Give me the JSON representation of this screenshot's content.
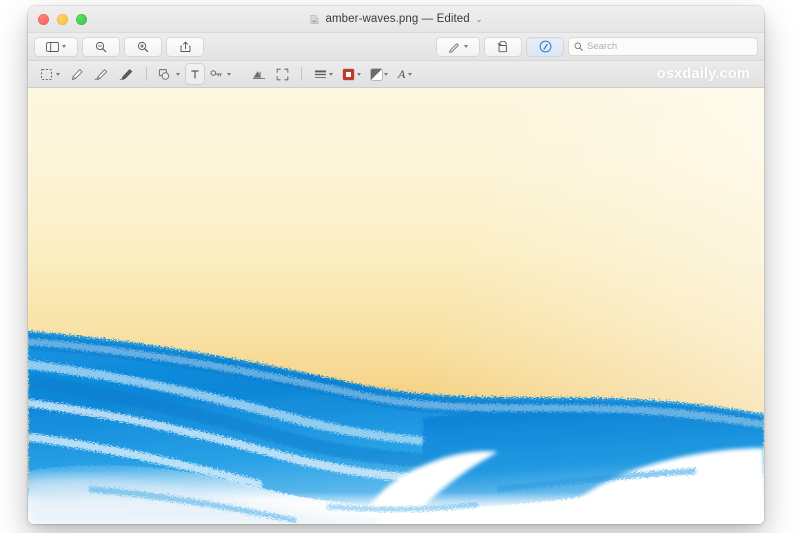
{
  "window": {
    "traffic_lights": [
      {
        "name": "close",
        "color": "#ff5f57"
      },
      {
        "name": "minimize",
        "color": "#febc2e"
      },
      {
        "name": "maximize",
        "color": "#28c840"
      }
    ],
    "title": {
      "filename": "amber-waves.png",
      "separator": "—",
      "state": "Edited",
      "full": "amber-waves.png — Edited",
      "chevron": "⌄",
      "doc_icon": "preview-document-icon"
    }
  },
  "toolbar": {
    "items": [
      {
        "name": "sidebar-toggle-button",
        "icon": "sidebar-icon",
        "label": "",
        "has_chevron": true,
        "active": false
      },
      {
        "name": "zoom-out-button",
        "icon": "zoom-out-icon",
        "label": "",
        "has_chevron": false,
        "active": false
      },
      {
        "name": "zoom-in-button",
        "icon": "zoom-in-icon",
        "label": "",
        "has_chevron": false,
        "active": false
      },
      {
        "name": "share-button",
        "icon": "share-icon",
        "label": "",
        "has_chevron": false,
        "active": false
      },
      {
        "name": "highlight-button",
        "icon": "highlighter-icon",
        "label": "",
        "has_chevron": true,
        "active": false
      },
      {
        "name": "rotate-button",
        "icon": "rotate-left-icon",
        "label": "",
        "has_chevron": false,
        "active": false
      },
      {
        "name": "markup-toggle-button",
        "icon": "markup-pen-circle-icon",
        "label": "",
        "has_chevron": false,
        "active": true
      }
    ],
    "search": {
      "placeholder": "Search",
      "value": "",
      "icon": "search-icon"
    }
  },
  "markup_toolbar": {
    "tools": [
      {
        "name": "selection-tool",
        "icon": "rect-selection-icon",
        "has_chevron": true
      },
      {
        "name": "instant-alpha-tool",
        "icon": "instant-alpha-icon",
        "has_chevron": false
      },
      {
        "name": "sketch-tool",
        "icon": "sketch-pen-icon",
        "has_chevron": false
      },
      {
        "name": "draw-tool",
        "icon": "draw-pen-icon",
        "has_chevron": false
      },
      {
        "name": "shapes-tool",
        "icon": "shapes-icon",
        "has_chevron": true
      },
      {
        "name": "text-tool",
        "icon": "text-box-icon",
        "has_chevron": false
      },
      {
        "name": "sign-tool",
        "icon": "signature-icon",
        "has_chevron": true
      },
      {
        "name": "adjust-color-tool",
        "icon": "adjust-color-icon",
        "has_chevron": false
      },
      {
        "name": "adjust-size-tool",
        "icon": "adjust-size-icon",
        "has_chevron": false
      },
      {
        "name": "shape-style-tool",
        "icon": "shape-style-icon",
        "has_chevron": true
      },
      {
        "name": "border-color-tool",
        "icon": "border-color-swatch",
        "has_chevron": true
      },
      {
        "name": "fill-color-tool",
        "icon": "fill-color-swatch",
        "has_chevron": true
      },
      {
        "name": "text-style-tool",
        "icon": "font-style-icon",
        "has_chevron": true
      }
    ],
    "border_color": "#c0392b",
    "fill_color": "#ffffff",
    "text_style_glyph": "A",
    "watermark": "osxdaily.com"
  },
  "image": {
    "name": "amber-waves.png",
    "description": "Amber sky over a stylized blue ocean wave with white foam",
    "colors": {
      "sky_top": "#fdf7e0",
      "sky_mid": "#f8e0a2",
      "sky_bottom": "#edb251",
      "wave_blue": "#0d86d8",
      "wave_blue_light": "#3aa9e8",
      "foam_white": "#ffffff"
    }
  }
}
